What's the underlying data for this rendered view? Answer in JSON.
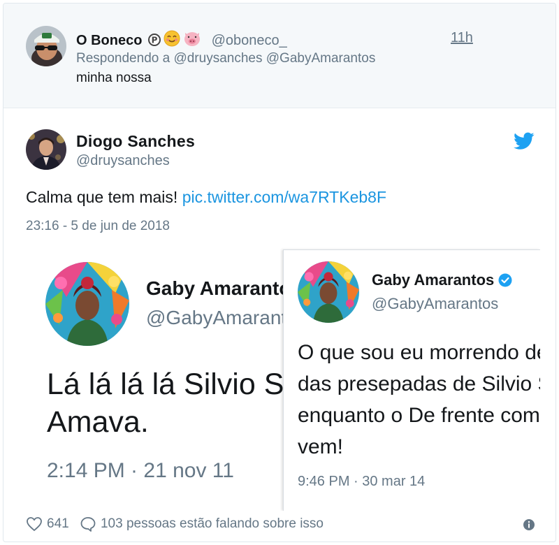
{
  "reply": {
    "name": "O Boneco",
    "emoji_glyphs": "😊🐷",
    "handle": "@oboneco_",
    "time": "11h",
    "replying_prefix": "Respondendo a",
    "replying_to": [
      "@druysanches",
      "@GabyAmarantos"
    ],
    "text": "minha nossa"
  },
  "tweet": {
    "name": "Diogo Sanches",
    "handle": "@druysanches",
    "text": "Calma que tem mais!",
    "link": "pic.twitter.com/wa7RTKeb8F",
    "timestamp": "23:16 - 5 de jun de 2018",
    "likes": "641",
    "talking": "103 pessoas estão falando sobre isso"
  },
  "media": {
    "left": {
      "name": "Gaby Amarantos",
      "handle": "@GabyAmarantos",
      "text": "Lá lá lá lá Silvio Santos\nAmava.",
      "date": "2:14 PM · 21 nov 11"
    },
    "right": {
      "name": "Gaby Amarantos",
      "handle": "@GabyAmarantos",
      "text": "O que sou eu morrendo de rir\ndas presepadas de Silvio Santos\nenquanto o De frente com Gabi não\nvem!",
      "date": "9:46 PM · 30 mar 14"
    }
  },
  "colors": {
    "link": "#1b95e0",
    "twitter_blue": "#1da1f2",
    "muted": "#657786",
    "reply_bg": "#f5f8fa"
  },
  "icons": [
    "pinterest-icon",
    "smiling-face-icon",
    "pig-face-icon",
    "twitter-bird-icon",
    "verified-badge-icon",
    "heart-icon",
    "comment-icon",
    "info-icon"
  ]
}
